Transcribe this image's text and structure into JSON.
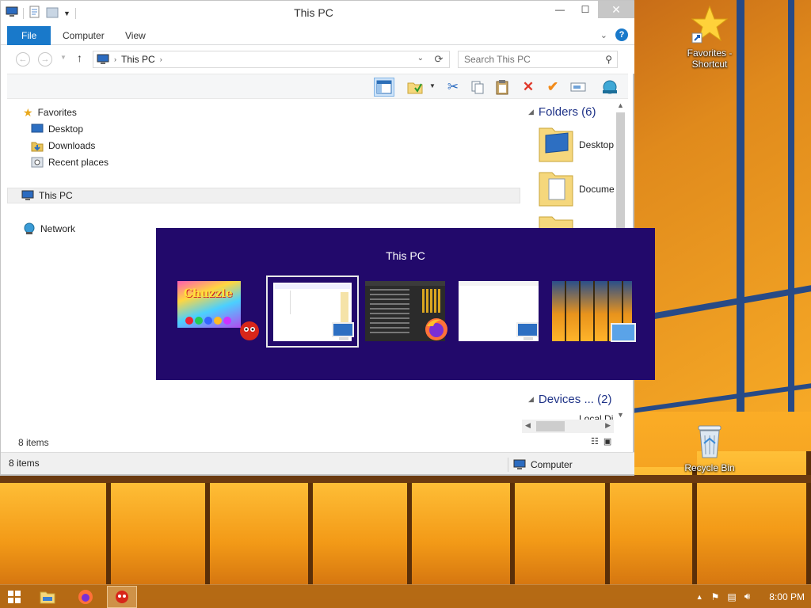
{
  "window": {
    "title": "This PC",
    "minimize": "—",
    "maximize": "☐",
    "close": "✕"
  },
  "ribbon": {
    "tabs": [
      "File",
      "Computer",
      "View"
    ]
  },
  "address": {
    "breadcrumb": "This PC",
    "search_placeholder": "Search This PC"
  },
  "navpane": {
    "favorites": "Favorites",
    "desktop": "Desktop",
    "downloads": "Downloads",
    "recent": "Recent places",
    "this_pc": "This PC",
    "network": "Network"
  },
  "content": {
    "folders_header": "Folders (6)",
    "folder_1": "Desktop",
    "folder_2": "Docume",
    "devices_header": "Devices ... (2)",
    "device_1": "Local Di"
  },
  "status": {
    "item_count_inner": "8 items",
    "item_count": "8 items",
    "location": "Computer"
  },
  "switcher": {
    "title": "This PC",
    "items": [
      {
        "name": "Chuzzle Deluxe",
        "logo": "Chuzzle"
      },
      {
        "name": "This PC"
      },
      {
        "name": "Firefox"
      },
      {
        "name": "This PC"
      },
      {
        "name": "Desktop"
      }
    ]
  },
  "desktop_icons": {
    "favorites": "Favorites - Shortcut",
    "recycle": "Recycle Bin"
  },
  "taskbar": {
    "clock": "8:00 PM"
  },
  "colors": {
    "accent": "#1979ca",
    "switcher_bg": "#22096b",
    "group_header": "#1e3287"
  }
}
